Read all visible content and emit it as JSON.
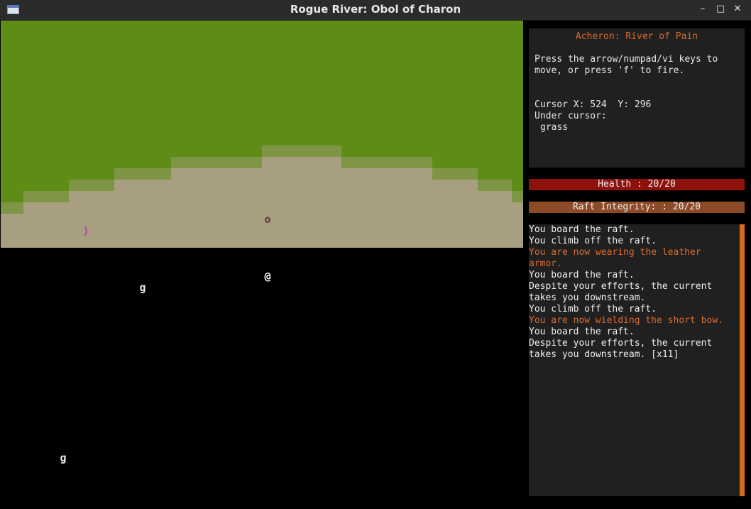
{
  "window": {
    "title": "Rogue River: Obol of Charon",
    "min_glyph": "–",
    "max_glyph": "□",
    "close_glyph": "✕"
  },
  "map": {
    "colors": {
      "grass": "#5f8c17",
      "sand": "#a79f7f",
      "water_shallow": "#7e95a4",
      "water_deep": "#004796"
    },
    "entities": [
      {
        "name": "player-character",
        "glyph": "@",
        "color": "#ffffff"
      },
      {
        "name": "obol-coin",
        "glyph": "o",
        "color": "#5a3a3a"
      },
      {
        "name": "purple-item",
        "glyph": ")",
        "color": "#b040b0"
      },
      {
        "name": "gnome-enemy-near",
        "glyph": "g",
        "color": "#e8e8e8"
      },
      {
        "name": "gnome-enemy-far",
        "glyph": "g",
        "color": "#e8e8e8"
      }
    ]
  },
  "sidebar": {
    "level_name": "Acheron: River of Pain",
    "instructions": "Press the arrow/numpad/vi keys to move, or press 'f' to fire.",
    "cursor_line": "Cursor X: 524  Y: 296",
    "under_label": "Under cursor:",
    "under_value": "grass",
    "health_text": "Health : 20/20",
    "raft_text": "Raft Integrity: : 20/20",
    "accent_color": "#d96c2e",
    "log": [
      {
        "text": "You board the raft.",
        "highlight": false
      },
      {
        "text": "You climb off the raft.",
        "highlight": false
      },
      {
        "text": "You are now wearing the leather armor.",
        "highlight": true
      },
      {
        "text": "You board the raft.",
        "highlight": false
      },
      {
        "text": "Despite your efforts, the current takes you downstream.",
        "highlight": false
      },
      {
        "text": "You climb off the raft.",
        "highlight": false
      },
      {
        "text": "You are now wielding the short bow.",
        "highlight": true
      },
      {
        "text": "You board the raft.",
        "highlight": false
      },
      {
        "text": "Despite your efforts, the current takes you downstream. [x11]",
        "highlight": false
      }
    ]
  }
}
